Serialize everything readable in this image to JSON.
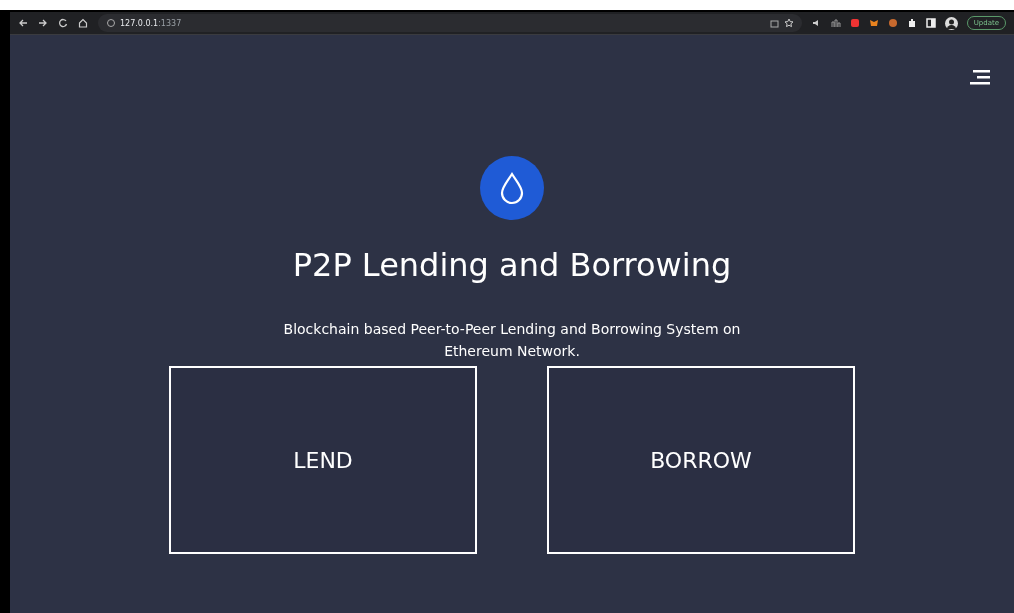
{
  "browser": {
    "address_host": "127.0.0.1",
    "address_port": ":1337",
    "update_button": "Update"
  },
  "hero": {
    "title": "P2P Lending and Borrowing",
    "subtitle": "Blockchain based Peer-to-Peer Lending and Borrowing System on Ethereum Network."
  },
  "actions": [
    {
      "label": "LEND"
    },
    {
      "label": "BORROW"
    }
  ]
}
